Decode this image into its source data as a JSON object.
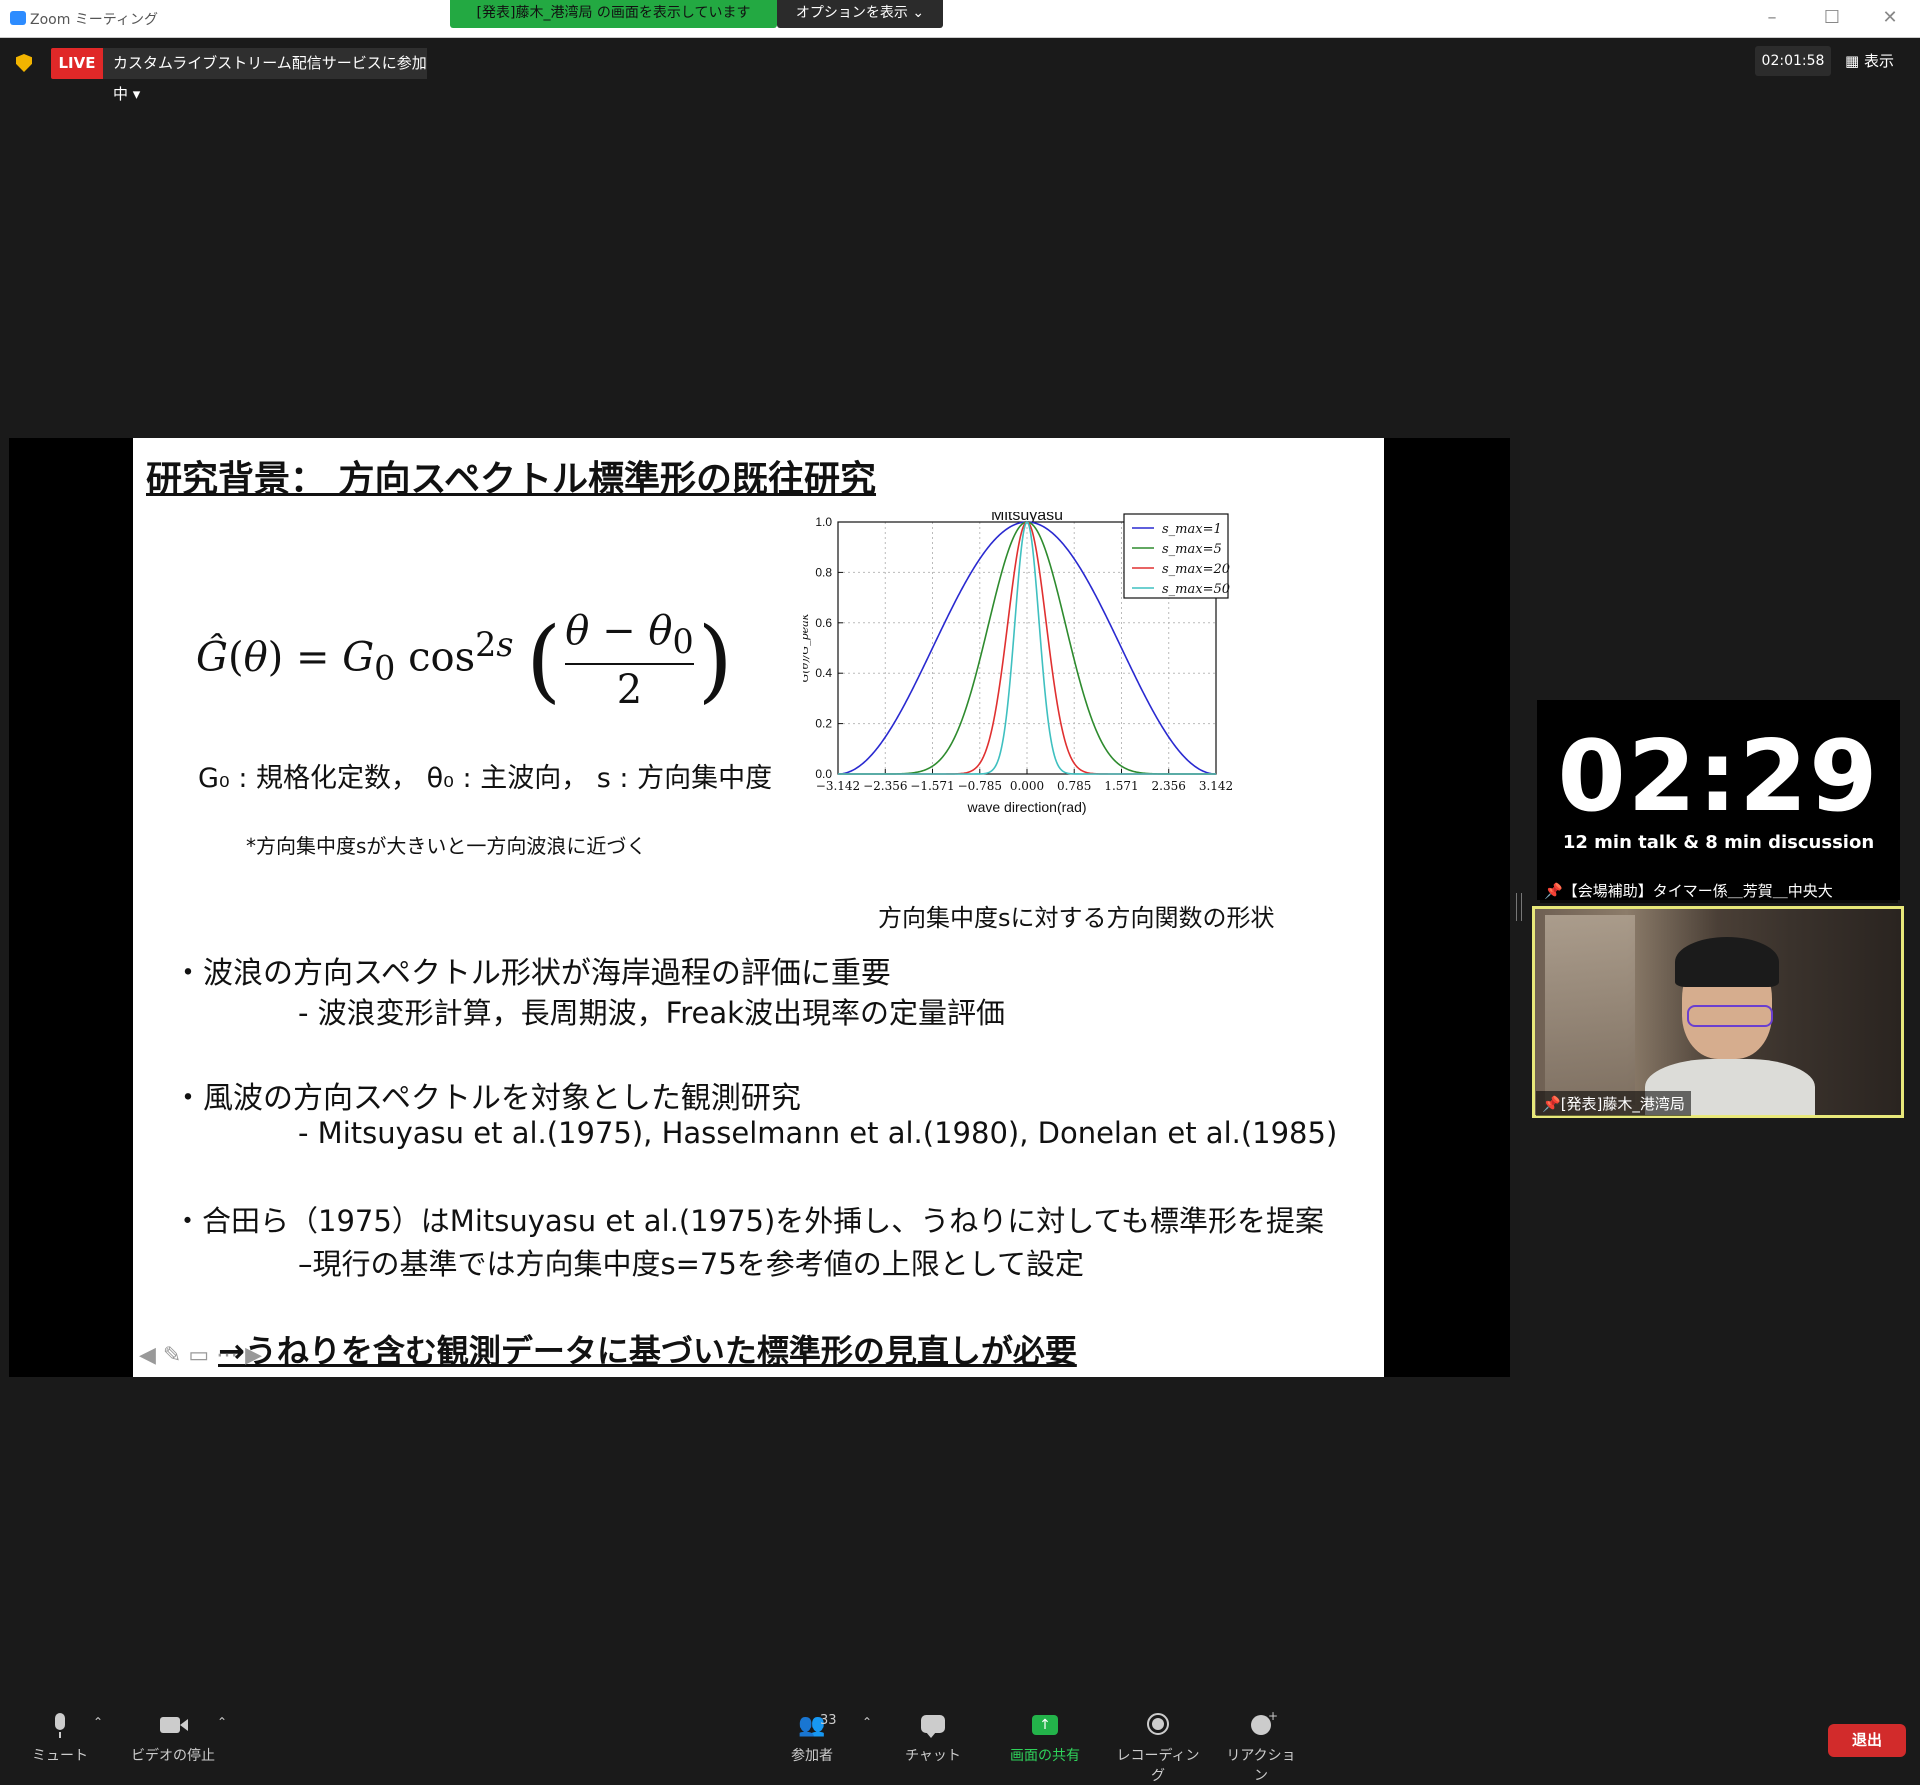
{
  "window": {
    "title": "Zoom ミーティング",
    "share_banner": "[発表]藤木_港湾局 の画面を表示しています",
    "options_label": "オプションを表示"
  },
  "live": {
    "badge": "LIVE",
    "status": "カスタムライブストリーム配信サービスに参加中"
  },
  "meeting_clock": "02:01:58",
  "view_label": "表示",
  "slide": {
    "title": "研究背景：  方向スペクトル標準形の既往研究",
    "symbols_line": "G₀ : 規格化定数， θ₀ : 主波向， s : 方向集中度",
    "note": "*方向集中度sが大きいと一方向波浪に近づく",
    "caption": "方向集中度sに対する方向関数の形状",
    "bullets": [
      {
        "text": "・波浪の方向スペクトル形状が海岸過程の評価に重要",
        "sub": "- 波浪変形計算，長周期波，Freak波出現率の定量評価"
      },
      {
        "text": "・風波の方向スペクトルを対象とした観測研究",
        "sub": "- Mitsuyasu et al.(1975), Hasselmann et al.(1980), Donelan et al.(1985)"
      },
      {
        "text": "・合田ら（1975）はMitsuyasu et al.(1975)を外挿し、うねりに対しても標準形を提案",
        "sub": "–現行の基準では方向集中度s=75を参考値の上限として設定"
      }
    ],
    "conclusion": "→うねりを含む観測データに基づいた標準形の見直しが必要"
  },
  "chart_data": {
    "type": "line",
    "title": "Mitsuyasu",
    "xlabel": "wave direction(rad)",
    "ylabel": "G(θ)/G_peak",
    "xlim": [
      -3.142,
      3.142
    ],
    "ylim": [
      0.0,
      1.0
    ],
    "xticks": [
      "-3.142",
      "-2.356",
      "-1.571",
      "-0.785",
      "0.000",
      "0.785",
      "1.571",
      "2.356",
      "3.142"
    ],
    "yticks": [
      "0.0",
      "0.2",
      "0.4",
      "0.6",
      "0.8",
      "1.0"
    ],
    "grid": true,
    "legend_position": "top-right",
    "function": "cos^(2s)(θ/2)",
    "series": [
      {
        "name": "s_max=1",
        "s": 1,
        "color": "#2a2ad0"
      },
      {
        "name": "s_max=5",
        "s": 5,
        "color": "#2e8b2e"
      },
      {
        "name": "s_max=20",
        "s": 20,
        "color": "#e03030"
      },
      {
        "name": "s_max=50",
        "s": 50,
        "color": "#3fc0c0"
      }
    ]
  },
  "timer": {
    "value": "02:29",
    "subtitle": "12 min talk & 8 min discussion",
    "label": "【会場補助】タイマー係＿芳賀＿中央大"
  },
  "speaker": {
    "name": "[発表]藤木_港湾局"
  },
  "toolbar": {
    "mute": "ミュート",
    "video": "ビデオの停止",
    "participants": "参加者",
    "participants_count": "33",
    "chat": "チャット",
    "share": "画面の共有",
    "recording": "レコーディング",
    "reaction": "リアクション",
    "leave": "退出"
  }
}
